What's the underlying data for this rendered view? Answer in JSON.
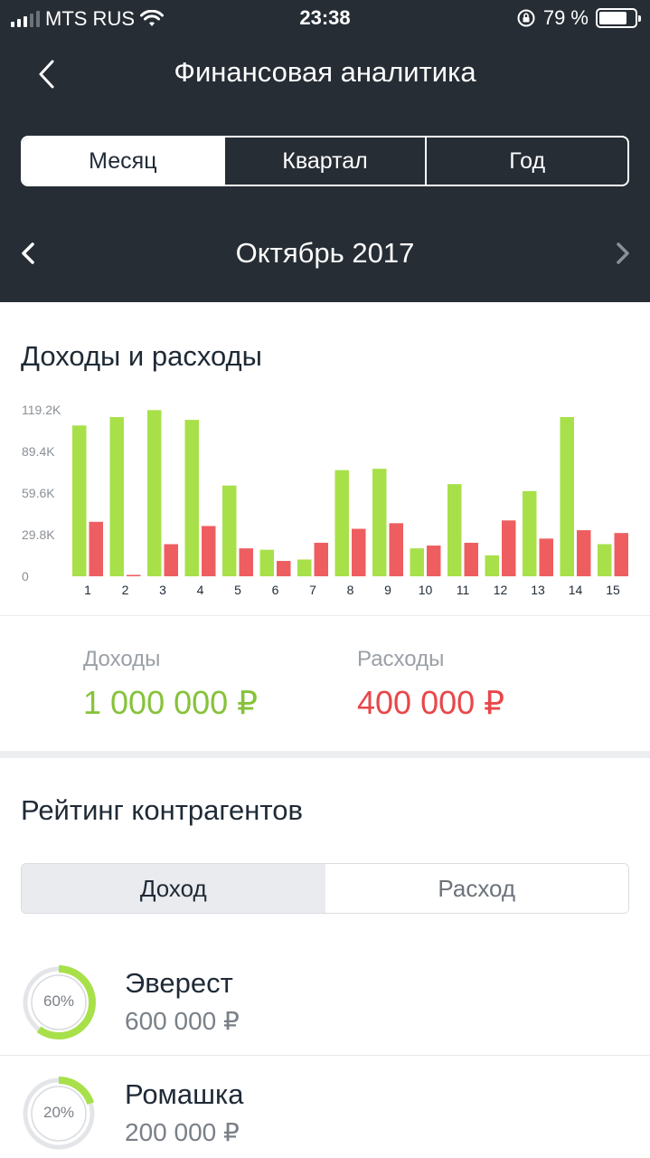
{
  "status_bar": {
    "carrier": "MTS RUS",
    "time": "23:38",
    "battery_text": "79 %",
    "battery_level": 0.79
  },
  "nav": {
    "title": "Финансовая аналитика",
    "back_icon": "chevron-left-icon"
  },
  "period_tabs": [
    {
      "label": "Месяц",
      "active": true
    },
    {
      "label": "Квартал",
      "active": false
    },
    {
      "label": "Год",
      "active": false
    }
  ],
  "month_switcher": {
    "label": "Октябрь 2017",
    "prev_icon": "chevron-left-icon",
    "next_icon": "chevron-right-icon"
  },
  "income_expense": {
    "title": "Доходы и расходы",
    "income_label": "Доходы",
    "income_value": "1 000 000 ₽",
    "expense_label": "Расходы",
    "expense_value": "400 000 ₽"
  },
  "chart_data": {
    "type": "bar",
    "categories": [
      "1",
      "2",
      "3",
      "4",
      "5",
      "6",
      "7",
      "8",
      "9",
      "10",
      "11",
      "12",
      "13",
      "14",
      "15"
    ],
    "series": [
      {
        "color": "#a8e04a",
        "values": [
          108,
          114,
          119,
          112,
          65,
          19,
          12,
          76,
          77,
          20,
          66,
          15,
          61,
          114,
          23
        ]
      },
      {
        "color": "#ee5e60",
        "values": [
          39,
          1,
          23,
          36,
          20,
          11,
          24,
          34,
          38,
          22,
          24,
          40,
          27,
          33,
          31
        ]
      }
    ],
    "y_ticks": [
      "0",
      "29.8K",
      "59.6K",
      "89.4K",
      "119.2K"
    ],
    "ylim": [
      0,
      119.2
    ],
    "grid": false
  },
  "counterparties": {
    "title": "Рейтинг контрагентов",
    "tabs": [
      {
        "label": "Доход",
        "active": true
      },
      {
        "label": "Расход",
        "active": false
      }
    ],
    "items": [
      {
        "name": "Эверест",
        "amount": "600 000 ₽",
        "percent_label": "60%",
        "share": 0.6
      },
      {
        "name": "Ромашка",
        "amount": "200 000 ₽",
        "percent_label": "20%",
        "share": 0.2
      }
    ]
  }
}
